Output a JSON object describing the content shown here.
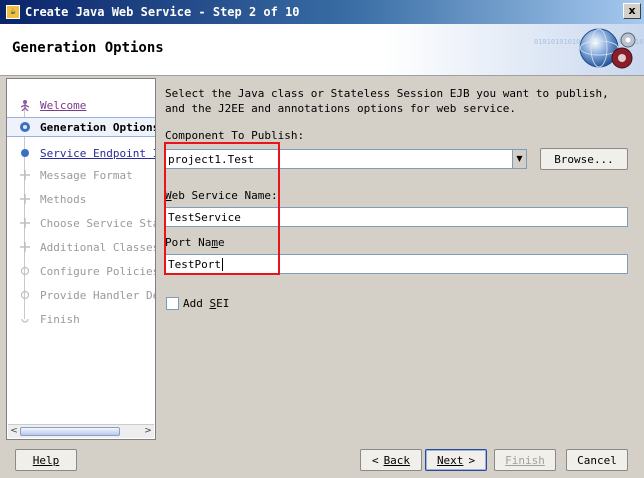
{
  "window": {
    "title": "Create Java Web Service - Step 2 of 10",
    "close_glyph": "x"
  },
  "header": {
    "title": "Generation Options",
    "graphic_icon": "globe-gears-icon",
    "binary_text": "0101010101010101010101 01010101010101"
  },
  "nav": {
    "items": [
      {
        "label": "Welcome",
        "state": "visited"
      },
      {
        "label": "Generation Options",
        "state": "current"
      },
      {
        "label": "Service Endpoint In",
        "state": "link"
      },
      {
        "label": "Message Format",
        "state": "disabled"
      },
      {
        "label": "Methods",
        "state": "disabled"
      },
      {
        "label": "Choose Service Stat",
        "state": "disabled"
      },
      {
        "label": "Additional Classes",
        "state": "disabled"
      },
      {
        "label": "Configure Policies",
        "state": "disabled"
      },
      {
        "label": "Provide Handler Det",
        "state": "disabled"
      },
      {
        "label": "Finish",
        "state": "disabled"
      }
    ]
  },
  "content": {
    "description": "Select the Java class or Stateless Session EJB you want to publish, and the J2EE and annotations options for web service.",
    "component_label": "Component To Publish:",
    "component_value": "project1.Test",
    "browse_label_pre": "Browse",
    "browse_label_post": "...",
    "browse_mnemonic": "",
    "ws_name_label_mn": "W",
    "ws_name_label_rest": "eb Service Name:",
    "ws_name_value": "TestService",
    "port_label_pre": "Port Na",
    "port_label_mn": "m",
    "port_label_post": "e",
    "port_value": "TestPort",
    "add_sei_pre": "Add ",
    "add_sei_mn": "S",
    "add_sei_post": "EI",
    "add_sei_checked": false
  },
  "footer": {
    "help": "Help",
    "back": "Back",
    "next": "Next",
    "finish": "Finish",
    "cancel": "Cancel",
    "back_glyph": "<",
    "next_glyph": ">"
  },
  "colors": {
    "titlebar_start": "#0a246a",
    "highlight_box": "#e8141b",
    "link": "#2b2b9b",
    "visited": "#7a3c8a"
  }
}
